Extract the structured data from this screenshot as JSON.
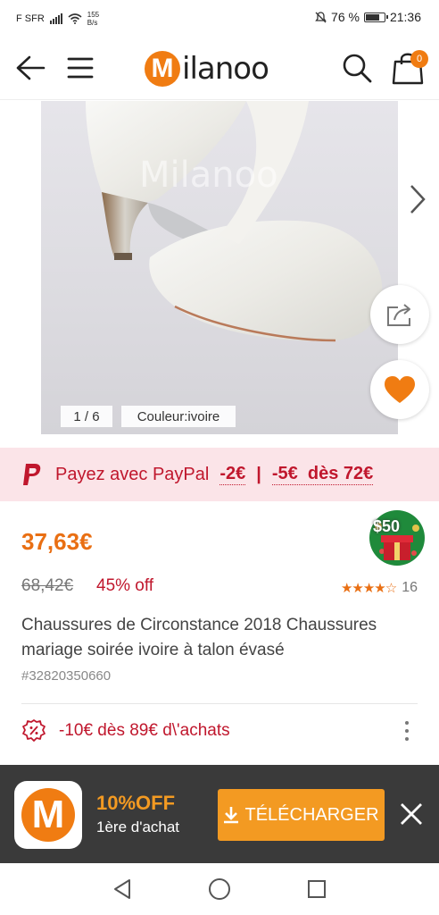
{
  "status_bar": {
    "carrier": "F SFR",
    "speed_value": "155",
    "speed_unit": "B/s",
    "battery": "76 %",
    "time": "21:36"
  },
  "header": {
    "back_icon": "back-arrow-icon",
    "menu_icon": "hamburger-menu-icon",
    "logo_letter": "M",
    "logo_text": "ilanoo",
    "search_icon": "search-icon",
    "cart_icon": "shopping-bag-icon",
    "cart_count": "0"
  },
  "gallery": {
    "watermark": "Milanoo",
    "counter": "1 / 6",
    "color_tag": "Couleur:ivoire",
    "next_icon": "chevron-right-icon",
    "share_icon": "share-icon",
    "favorite_icon": "heart-icon"
  },
  "paypal": {
    "text": "Payez avec PayPal",
    "discount1": "-2€",
    "separator": "|",
    "discount2": "-5€  dès 72€"
  },
  "product": {
    "price": "37,63€",
    "badge_label": "$50",
    "old_price": "68,42€",
    "off": "45% off",
    "rating_stars": "★★★★☆",
    "rating_value": 4,
    "review_count": "16",
    "title": "Chaussures de Circonstance 2018 Chaussures mariage soirée ivoire à talon évasé",
    "sku": "#32820350660"
  },
  "coupon": {
    "text": "-10€ dès 89€ d\\'achats"
  },
  "app_banner": {
    "logo_letter": "M",
    "promo_title": "10%OFF",
    "promo_sub": "1ère d'achat",
    "download_label": "TÉLÉCHARGER"
  },
  "colors": {
    "brand_orange": "#f07c12",
    "paypal_red": "#c0172d",
    "banner_bg": "#3a3a3a"
  }
}
